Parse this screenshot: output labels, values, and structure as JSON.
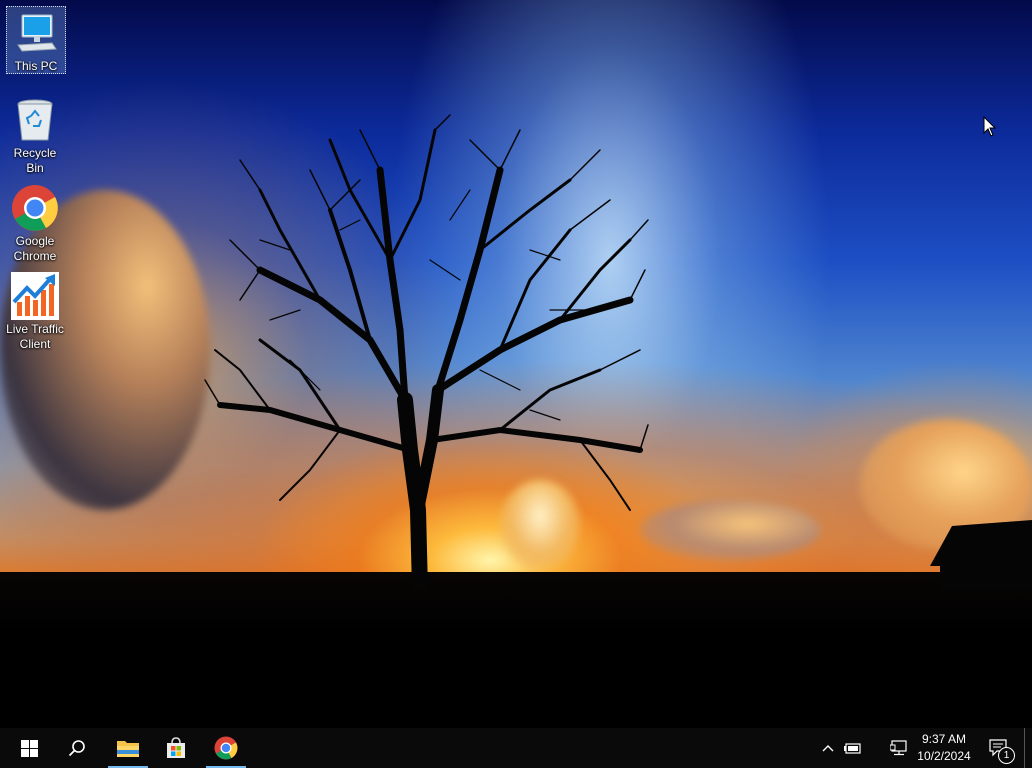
{
  "desktop": {
    "icons": [
      {
        "label": "This PC",
        "icon": "computer-icon"
      },
      {
        "label": "Recycle\nBin",
        "icon": "recycle-bin-icon"
      },
      {
        "label": "Google\nChrome",
        "icon": "chrome-icon"
      },
      {
        "label": "Live Traffic\nClient",
        "icon": "traffic-chart-icon"
      }
    ]
  },
  "taskbar": {
    "start_icon": "windows-logo-icon",
    "search_icon": "search-icon",
    "pinned": [
      {
        "name": "File Explorer",
        "icon": "folder-icon"
      },
      {
        "name": "Microsoft Store",
        "icon": "store-icon"
      },
      {
        "name": "Google Chrome",
        "icon": "chrome-icon"
      }
    ],
    "tray": {
      "time": "9:37 AM",
      "date": "10/2/2024",
      "notification_count": "1"
    }
  },
  "colors": {
    "taskbar_bg": "#0a0a0a",
    "active_indicator": "#76b9ed",
    "selection_bg": "#5a78b4"
  }
}
